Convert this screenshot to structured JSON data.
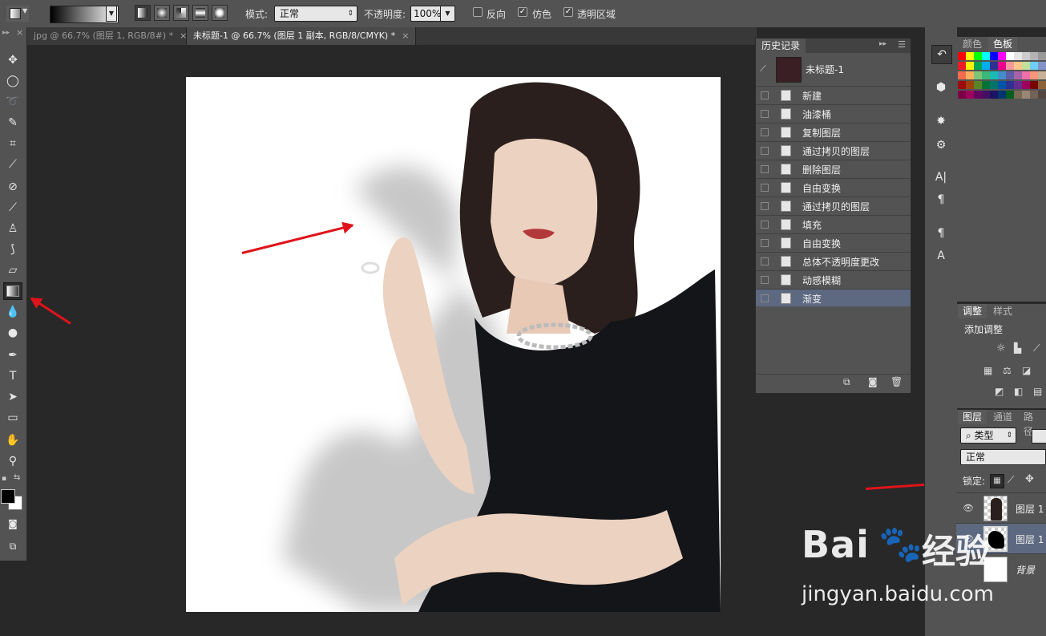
{
  "options_bar": {
    "mode_label": "模式:",
    "mode_value": "正常",
    "opacity_label": "不透明度:",
    "opacity_value": "100%",
    "reverse_label": "反向",
    "dither_label": "仿色",
    "transparency_label": "透明区域",
    "reverse_checked": false,
    "dither_checked": true,
    "transparency_checked": true
  },
  "tabs": [
    {
      "label": "jpg @ 66.7% (图层 1, RGB/8#) *",
      "close": "×"
    },
    {
      "label": "未标题-1 @ 66.7% (图层 1 副本, RGB/8/CMYK) *",
      "close": "×"
    }
  ],
  "history": {
    "title": "历史记录",
    "snapshot_name": "未标题-1",
    "items": [
      "新建",
      "油漆桶",
      "复制图层",
      "通过拷贝的图层",
      "删除图层",
      "自由变换",
      "通过拷贝的图层",
      "填充",
      "自由变换",
      "总体不透明度更改",
      "动感模糊",
      "渐变"
    ],
    "active_index": 11
  },
  "swatch_panel": {
    "tab1": "颜色",
    "tab2": "色板"
  },
  "adjust_panel": {
    "tab1": "调整",
    "tab2": "样式",
    "title": "添加调整"
  },
  "layers_panel": {
    "tab1": "图层",
    "tab2": "通道",
    "tab3": "路径",
    "filter_label": "类型",
    "blend_mode": "正常",
    "lock_label": "锁定:",
    "layers": [
      {
        "name": "图层 1",
        "visible": true
      },
      {
        "name": "图层 1",
        "visible": true
      },
      {
        "name": "背景",
        "visible": false
      }
    ]
  },
  "watermark": {
    "brand": "Bai",
    "brand2": "经验",
    "url": "jingyan.baidu.com"
  },
  "colors": {
    "accent_red": "#e0131a",
    "selection_blue": "#5d6980"
  }
}
